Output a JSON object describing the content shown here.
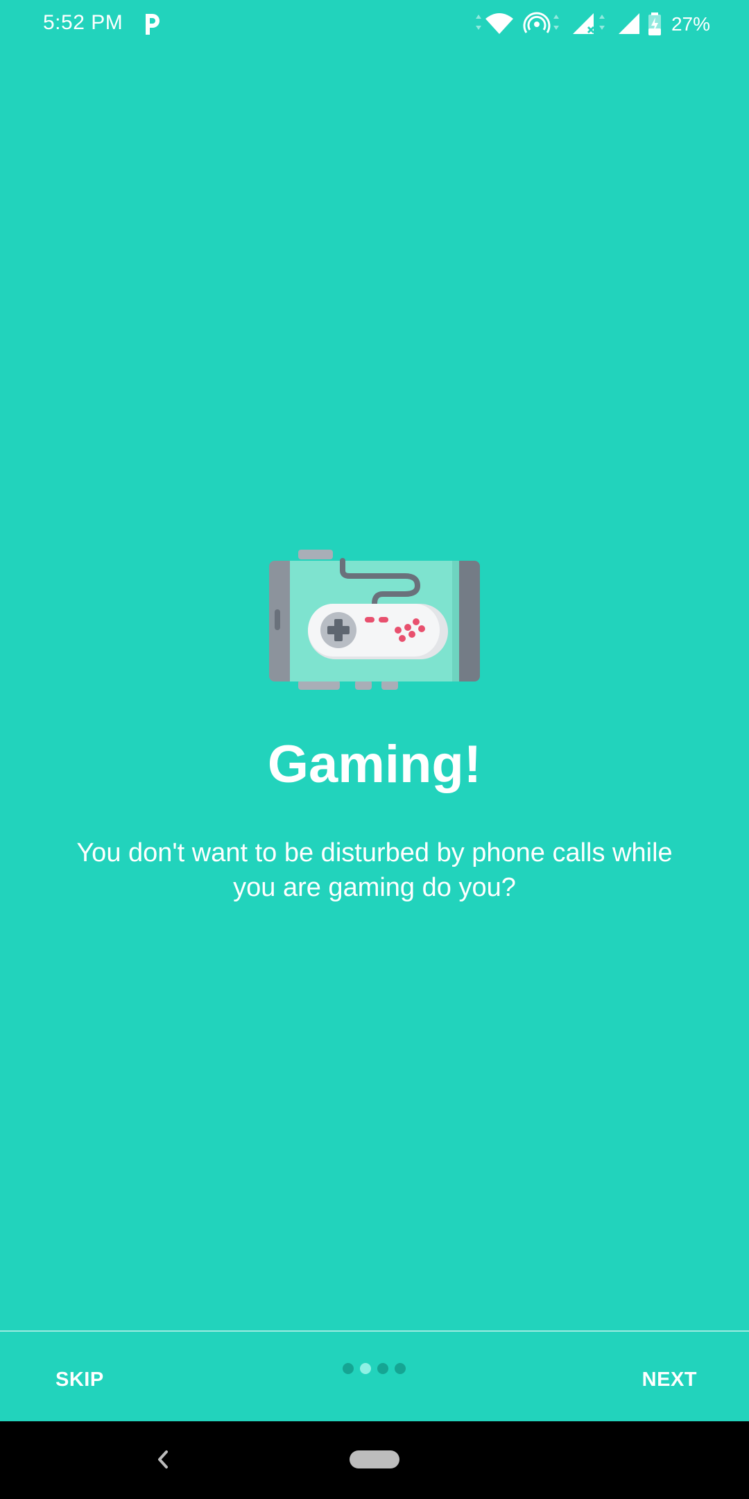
{
  "status_bar": {
    "time": "5:52 PM",
    "battery_percent": "27%",
    "icons": [
      "pandora-icon",
      "wifi-icon",
      "hotspot-icon",
      "signal-no-data-icon",
      "signal-icon",
      "battery-charging-icon"
    ]
  },
  "onboarding": {
    "illustration_icon": "game-controller-icon",
    "title": "Gaming!",
    "description": "You don't want to be disturbed by phone calls while you are gaming do you?"
  },
  "bottom_bar": {
    "skip_label": "SKIP",
    "next_label": "NEXT",
    "page_count": 4,
    "active_page": 2
  },
  "nav_bar": {
    "icons": [
      "back-icon",
      "home-pill-icon"
    ]
  },
  "colors": {
    "background": "#22D3BC",
    "dot_inactive": "#15A593",
    "dot_active": "#8EF1E4",
    "text": "#FFFFFF"
  }
}
